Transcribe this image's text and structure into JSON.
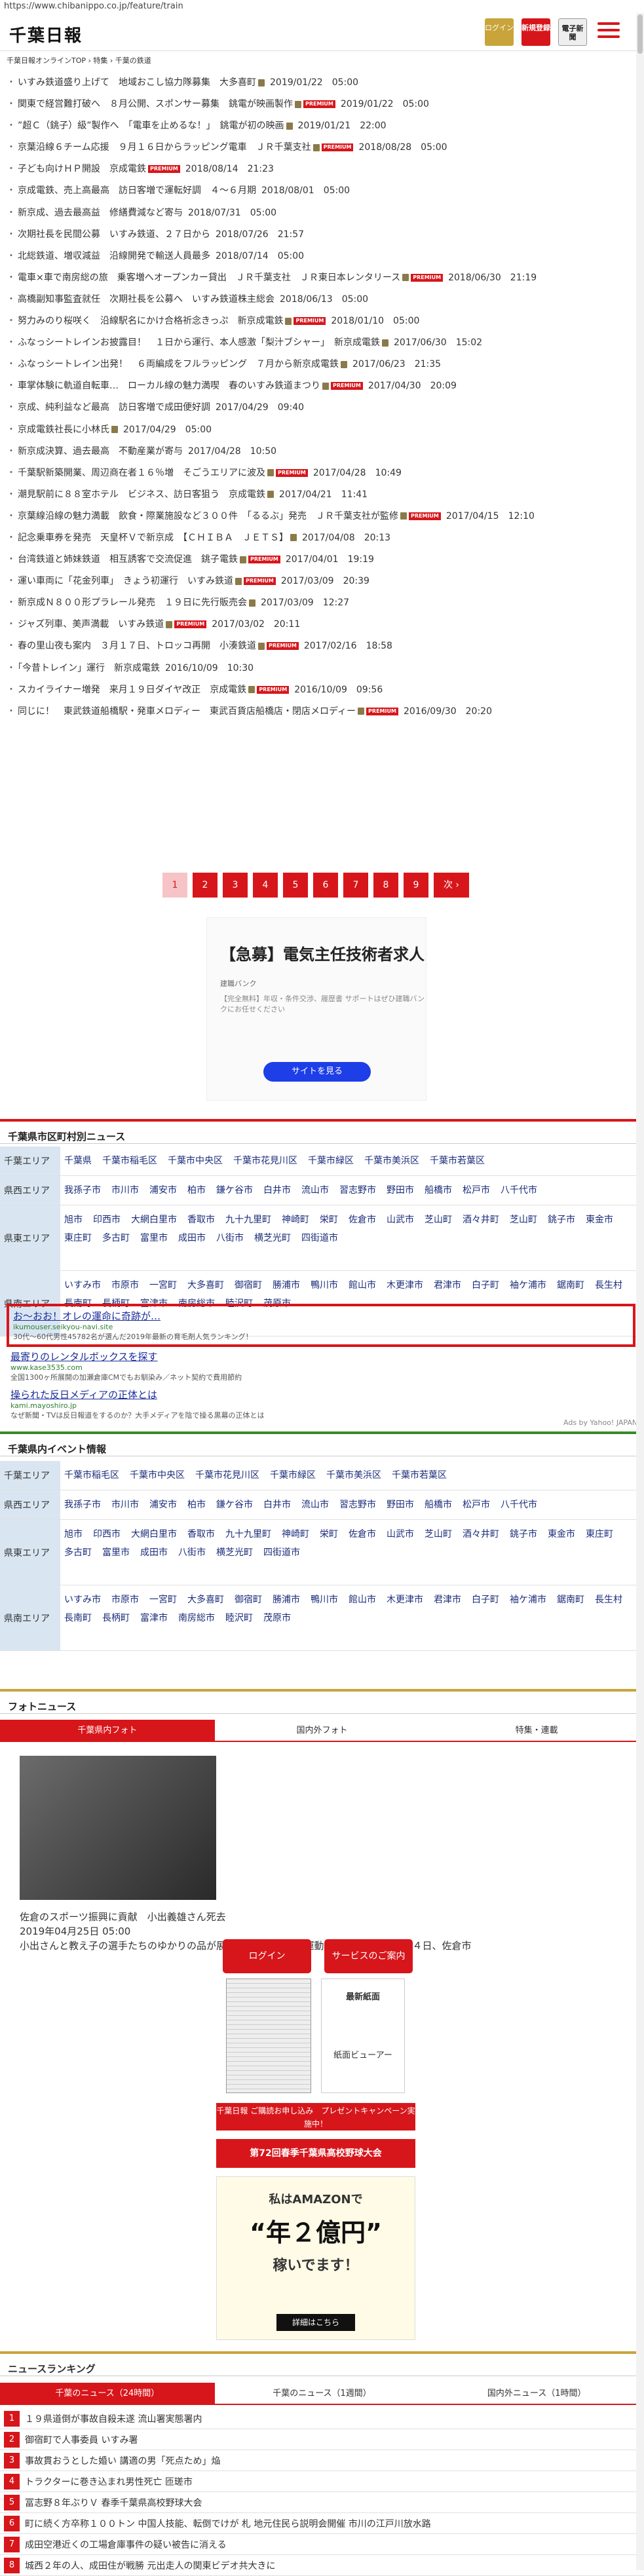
{
  "browser": {
    "url": "https://www.chibanippo.co.jp/feature/train"
  },
  "header": {
    "logo": "千葉日報",
    "login_label": "ログイン",
    "register_label": "新規登録",
    "paper_label": "電子新聞",
    "menu_icon": "hamburger-icon"
  },
  "breadcrumb": "千葉日報オンラインTOP › 特集 › 千葉の鉄道",
  "articles": [
    {
      "title": "いすみ鉄道盛り上げて　地域おこし協力隊募集　大多喜町",
      "date": "2019/01/22　05:00",
      "pic": true,
      "premium": false
    },
    {
      "title": "関東で経営難打破へ　８月公開、スポンサー募集　銚電が映画製作",
      "date": "2019/01/22　05:00",
      "pic": true,
      "premium": true
    },
    {
      "title": "”超Ｃ（銚子）級”製作へ　「電車を止めるな！」　銚電が初の映画",
      "date": "2019/01/21　22:00",
      "pic": true,
      "premium": false
    },
    {
      "title": "京葉沿線６チーム応援　９月１６日からラッピング電車　ＪＲ千葉支社",
      "date": "2018/08/28　05:00",
      "pic": true,
      "premium": true
    },
    {
      "title": "子ども向けＨＰ開設　京成電鉄",
      "date": "2018/08/14　21:23",
      "pic": false,
      "premium": true
    },
    {
      "title": "京成電鉄、売上高最高　訪日客増で運転好調　４～６月期",
      "date": "2018/08/01　05:00",
      "pic": false,
      "premium": false
    },
    {
      "title": "新京成、過去最高益　修繕費減など寄与",
      "date": "2018/07/31　05:00",
      "pic": false,
      "premium": false
    },
    {
      "title": "次期社長を民間公募　いすみ鉄道、２７日から",
      "date": "2018/07/26　21:57",
      "pic": false,
      "premium": false
    },
    {
      "title": "北総鉄道、増収減益　沿線開発で輸送人員最多",
      "date": "2018/07/14　05:00",
      "pic": false,
      "premium": false
    },
    {
      "title": "電車×車で南房総の旅　乗客増へオープンカー貸出　ＪＲ千葉支社　ＪＲ東日本レンタリース",
      "date": "2018/06/30　21:19",
      "pic": true,
      "premium": true
    },
    {
      "title": "高橋副知事監査就任　次期社長を公募へ　いすみ鉄道株主総会",
      "date": "2018/06/13　05:00",
      "pic": false,
      "premium": false
    },
    {
      "title": "努力みのり桜咲く　沿線駅名にかけ合格祈念きっぷ　新京成電鉄",
      "date": "2018/01/10　05:00",
      "pic": true,
      "premium": true
    },
    {
      "title": "ふなっシートレインお披露目！　１日から運行、本人感激「梨汁ブシャー」　新京成電鉄",
      "date": "2017/06/30　15:02",
      "pic": true,
      "premium": false
    },
    {
      "title": "ふなっシートレイン出発！　６両編成をフルラッピング　７月から新京成電鉄",
      "date": "2017/06/23　21:35",
      "pic": true,
      "premium": false
    },
    {
      "title": "車掌体験に軌道自転車…　ローカル線の魅力満喫　春のいすみ鉄道まつり",
      "date": "2017/04/30　20:09",
      "pic": true,
      "premium": true
    },
    {
      "title": "京成、純利益など最高　訪日客増で成田便好調",
      "date": "2017/04/29　09:40",
      "pic": false,
      "premium": false
    },
    {
      "title": "京成電鉄社長に小林氏",
      "date": "2017/04/29　05:00",
      "pic": true,
      "premium": false
    },
    {
      "title": "新京成決算、過去最高　不動産業が寄与",
      "date": "2017/04/28　10:50",
      "pic": false,
      "premium": false
    },
    {
      "title": "千葉駅新築開業、周辺商在者１６％増　そごうエリアに波及",
      "date": "2017/04/28　10:49",
      "pic": true,
      "premium": true
    },
    {
      "title": "潮見駅前に８８室ホテル　ビジネス、訪日客狙う　京成電鉄",
      "date": "2017/04/21　11:41",
      "pic": true,
      "premium": false
    },
    {
      "title": "京葉線沿線の魅力満載　飲食・際業施設など３００件　「るるぶ」発売　ＪＲ千葉支社が監修",
      "date": "2017/04/15　12:10",
      "pic": true,
      "premium": true
    },
    {
      "title": "記念乗車券を発売　天皇杯Ｖで新京成　【ＣＨＩＢＡ　ＪＥＴＳ】",
      "date": "2017/04/08　20:13",
      "pic": true,
      "premium": false
    },
    {
      "title": "台湾鉄道と姉妹鉄道　相互誘客で交流促進　銚子電鉄",
      "date": "2017/04/01　19:19",
      "pic": true,
      "premium": true
    },
    {
      "title": "運い車両に「花金列車」　きょう初運行　いすみ鉄道",
      "date": "2017/03/09　20:39",
      "pic": true,
      "premium": true
    },
    {
      "title": "新京成Ｎ８００形プラレール発売　１９日に先行販売会",
      "date": "2017/03/09　12:27",
      "pic": true,
      "premium": false
    },
    {
      "title": "ジャズ列車、美声満載　いすみ鉄道",
      "date": "2017/03/02　20:11",
      "pic": true,
      "premium": true
    },
    {
      "title": "春の里山夜も案内　３月１７日、トロッコ再開　小湊鉄道",
      "date": "2017/02/16　18:58",
      "pic": true,
      "premium": true
    },
    {
      "title": "「今昔トレイン」運行　新京成電鉄",
      "date": "2016/10/09　10:30",
      "pic": false,
      "premium": false
    },
    {
      "title": "スカイライナー増発　来月１９日ダイヤ改正　京成電鉄",
      "date": "2016/10/09　09:56",
      "pic": true,
      "premium": true
    },
    {
      "title": "同じに！　東武鉄道船橋駅・発車メロディー　東武百貨店船橋店・閉店メロディー",
      "date": "2016/09/30　20:20",
      "pic": true,
      "premium": true
    }
  ],
  "pagination": {
    "pages": [
      "1",
      "2",
      "3",
      "4",
      "5",
      "6",
      "7",
      "8",
      "9"
    ],
    "next": "次 ›"
  },
  "ad": {
    "title": "【急募】電気主任技術者求人",
    "company": "建職バンク",
    "desc": "【完全無料】年収・条件交渉、履歴書\nサポートはぜひ建職バンクにお任せください",
    "button": "サイトを見る"
  },
  "news_area": {
    "heading": "千葉県市区町村別ニュース",
    "rows": [
      {
        "key": "千葉エリア",
        "vals": [
          "千葉県",
          "千葉市稲毛区",
          "千葉市中央区",
          "千葉市花見川区",
          "千葉市緑区",
          "千葉市美浜区",
          "千葉市若葉区"
        ]
      },
      {
        "key": "県西エリア",
        "vals": [
          "我孫子市",
          "市川市",
          "浦安市",
          "柏市",
          "鎌ケ谷市",
          "白井市",
          "流山市",
          "習志野市",
          "野田市",
          "船橋市",
          "松戸市",
          "八千代市"
        ]
      },
      {
        "key": "県東エリア",
        "vals": [
          "旭市",
          "印西市",
          "大網白里市",
          "香取市",
          "九十九里町",
          "神崎町",
          "栄町",
          "佐倉市",
          "山武市",
          "芝山町",
          "酒々井町",
          "芝山町",
          "銚子市",
          "東金市",
          "東庄町",
          "多古町",
          "富里市",
          "成田市",
          "八街市",
          "横芝光町",
          "四街道市"
        ]
      },
      {
        "key": "県南エリア",
        "vals": [
          "いすみ市",
          "市原市",
          "一宮町",
          "大多喜町",
          "御宿町",
          "勝浦市",
          "鴨川市",
          "館山市",
          "木更津市",
          "君津市",
          "白子町",
          "袖ケ浦市",
          "鋸南町",
          "長生村",
          "長南町",
          "長柄町",
          "富津市",
          "南房総市",
          "睦沢町",
          "茂原市"
        ]
      }
    ]
  },
  "text_ads": [
    {
      "title": "お〜おお！オレの運命に奇跡が…",
      "url": "ikumouser.seikyou-navi.site",
      "desc": "30代〜60代男性45782名が選んだ2019年最新の育毛剤人気ランキング！"
    },
    {
      "title": "最寄りのレンタルボックスを探す",
      "url": "www.kase3535.com",
      "desc": "全国1300ヶ所展開の加瀬倉庫CMでもお馴染み／ネット契約で費用節約"
    },
    {
      "title": "操られた反日メディアの正体とは",
      "url": "kami.mayoshiro.jp",
      "desc": "なぜ新聞・TVは反日報道をするのか？大手メディアを陰で操る黒幕の正体とは"
    }
  ],
  "yahoo_label": "Ads by Yahoo! JAPAN",
  "events_area": {
    "heading": "千葉県内イベント情報",
    "rows": [
      {
        "key": "千葉エリア",
        "vals": [
          "千葉市稲毛区",
          "千葉市中央区",
          "千葉市花見川区",
          "千葉市緑区",
          "千葉市美浜区",
          "千葉市若葉区"
        ]
      },
      {
        "key": "県西エリア",
        "vals": [
          "我孫子市",
          "市川市",
          "浦安市",
          "柏市",
          "鎌ケ谷市",
          "白井市",
          "流山市",
          "習志野市",
          "野田市",
          "船橋市",
          "松戸市",
          "八千代市"
        ]
      },
      {
        "key": "県東エリア",
        "vals": [
          "旭市",
          "印西市",
          "大網白里市",
          "香取市",
          "九十九里町",
          "神崎町",
          "栄町",
          "佐倉市",
          "山武市",
          "芝山町",
          "酒々井町",
          "銚子市",
          "東金市",
          "東庄町",
          "多古町",
          "富里市",
          "成田市",
          "八街市",
          "横芝光町",
          "四街道市"
        ]
      },
      {
        "key": "県南エリア",
        "vals": [
          "いすみ市",
          "市原市",
          "一宮町",
          "大多喜町",
          "御宿町",
          "勝浦市",
          "鴨川市",
          "館山市",
          "木更津市",
          "君津市",
          "白子町",
          "袖ケ浦市",
          "鋸南町",
          "長生村",
          "長南町",
          "長柄町",
          "富津市",
          "南房総市",
          "睦沢町",
          "茂原市"
        ]
      }
    ]
  },
  "photo_news": {
    "heading": "フォトニュース",
    "tabs": [
      "千葉県内フォト",
      "国内外フォト",
      "特集・連載"
    ],
    "caption": "佐倉のスポーツ振興に貢献　小出義雄さん死去",
    "date": "2019年04月25日 05:00",
    "body": "小出さんと教え子の選手たちのゆかりの品が展示されている佐倉運動公園陸上競技場＝２４日、佐倉市"
  },
  "sidebar": {
    "login": "ログイン",
    "service": "サービスのご案内",
    "newest_paper": "最新紙面",
    "viewer": "紙面ビューアー",
    "banner1": "千葉日報 ご購読お申し込み　プレゼントキャンペーン実施中！",
    "banner2": "第72回春季千葉県高校野球大会",
    "banner3_a": "私はAMAZONで",
    "banner3_b": "“年２億円”",
    "banner3_c": "稼いでます！",
    "banner3_cta": "詳細はこちら"
  },
  "ranking": {
    "heading": "ニュースランキング",
    "tabs": [
      "千葉のニュース（24時間）",
      "千葉のニュース（1週間）",
      "国内外ニュース（1時間）"
    ],
    "items": [
      "１９県道倒が事故自殺未遂 流山署実態署内",
      "御宿町で人事委員 いすみ署",
      "事故貫おうとした婚い 講適の男「死点ため」焔",
      "トラクターに巻き込まれ男性死亡 匝瑳市",
      "冨志野８年ぶりＶ 春季千葉県高校野球大会",
      "町に続く方卒称１００トン 中国人技能、転倒でけが 札 地元住民ら説明会開催 市川の江戸川放水路",
      "成田空港近くの工場倉庫事件の疑い被告に消える",
      "城西２年の人、成田住が戦勝 元出走人の関東ビデオ共大きに"
    ]
  }
}
